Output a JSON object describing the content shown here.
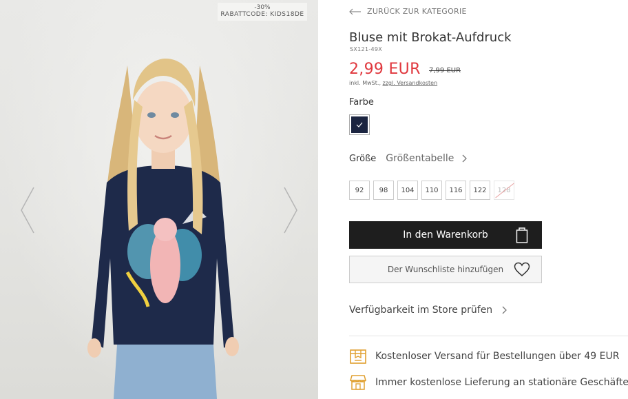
{
  "gallery": {
    "promo_discount": "-30%",
    "promo_code": "RABATTCODE: KIDS18DE"
  },
  "nav": {
    "back_label": "ZURÜCK ZUR KATEGORIE"
  },
  "product": {
    "title": "Bluse mit Brokat-Aufdruck",
    "sku": "SX121-49X",
    "price": "2,99 EUR",
    "old_price": "7,99 EUR",
    "tax_note": "inkl. MwSt.,",
    "shipping_link": "zzgl. Versandkosten",
    "accent_color": "#e0383e"
  },
  "color": {
    "label": "Farbe",
    "selected_hex": "#1b2440"
  },
  "size": {
    "label": "Größe",
    "table_link": "Größentabelle",
    "options": [
      {
        "label": "92",
        "available": true
      },
      {
        "label": "98",
        "available": true
      },
      {
        "label": "104",
        "available": true
      },
      {
        "label": "110",
        "available": true
      },
      {
        "label": "116",
        "available": true
      },
      {
        "label": "122",
        "available": true
      },
      {
        "label": "128",
        "available": false
      }
    ]
  },
  "actions": {
    "cart_label": "In den Warenkorb",
    "wishlist_label": "Der Wunschliste hinzufügen",
    "store_check_label": "Verfügbarkeit im Store prüfen"
  },
  "benefits": {
    "shipping": "Kostenloser Versand für Bestellungen über 49 EUR",
    "store_delivery": "Immer kostenlose Lieferung an stationäre Geschäfte",
    "icon_color": "#e0a030"
  },
  "icons": {
    "back": "arrow-left-icon",
    "prev": "chevron-left-icon",
    "next": "chevron-right-icon",
    "check": "checkmark-icon",
    "bag": "shopping-bag-icon",
    "heart": "heart-icon",
    "box": "package-icon",
    "store": "store-icon"
  }
}
